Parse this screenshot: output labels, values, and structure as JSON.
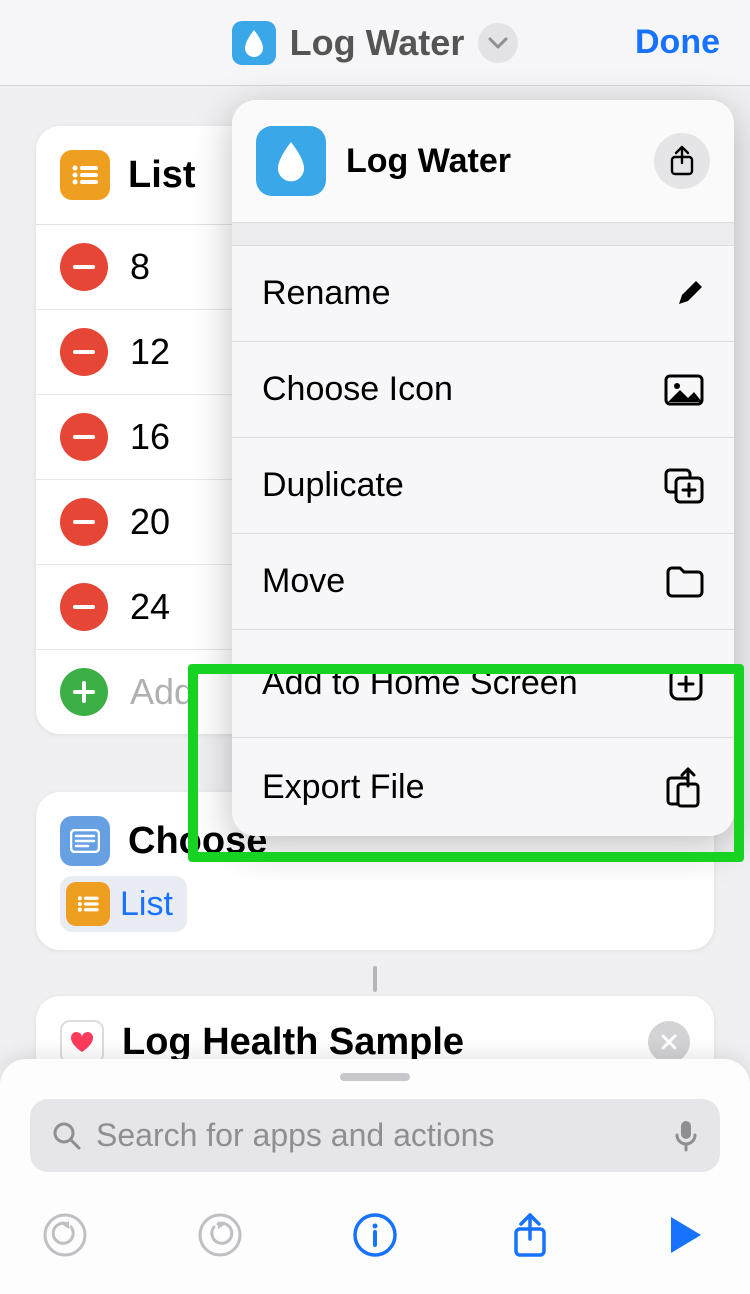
{
  "nav": {
    "title": "Log Water",
    "done": "Done"
  },
  "list_card": {
    "title": "List",
    "items": [
      "8",
      "12",
      "16",
      "20",
      "24"
    ],
    "add_placeholder": "Add"
  },
  "choose_card": {
    "title": "Choose",
    "pill_label": "List"
  },
  "log_health_card": {
    "title": "Log Health Sample"
  },
  "popover": {
    "title": "Log Water",
    "menu": {
      "rename": "Rename",
      "choose_icon": "Choose Icon",
      "duplicate": "Duplicate",
      "move": "Move",
      "add_home": "Add to Home Screen",
      "export": "Export File"
    }
  },
  "search": {
    "placeholder": "Search for apps and actions"
  }
}
